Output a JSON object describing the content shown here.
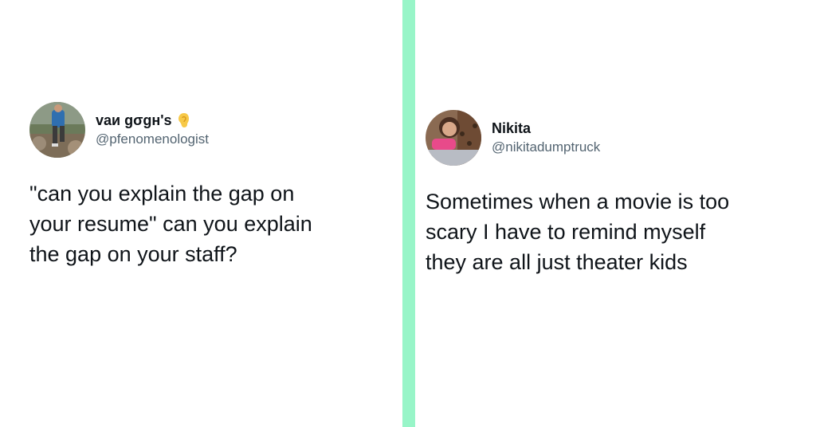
{
  "colors": {
    "divider": "#98f5c8",
    "name": "#0f1419",
    "handle": "#536471"
  },
  "left_tweet": {
    "display_name": "vaи gσgн's",
    "emoji_icon": "ear-emoji-icon",
    "handle": "@pfenomenologist",
    "lines": [
      "\"can you explain the gap on",
      "your resume\" can you explain",
      "the gap on your staff?"
    ]
  },
  "right_tweet": {
    "display_name": "Nikita",
    "handle": "@nikitadumptruck",
    "lines": [
      "Sometimes when a movie is too",
      "scary I have to remind myself",
      "they are all just theater kids"
    ]
  }
}
